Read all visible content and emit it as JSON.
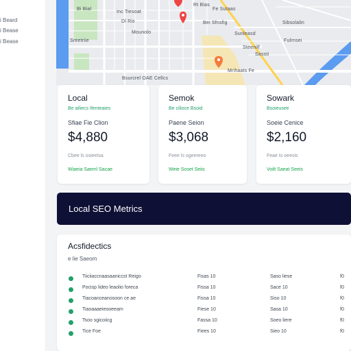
{
  "sidebar": {
    "items": [
      {
        "label": "i Beard"
      },
      {
        "label": "i Bease"
      },
      {
        "label": "i Bease"
      }
    ]
  },
  "map": {
    "labels": [
      "Bi Bial",
      "Dl Ris",
      "Mounolo",
      "Inc Tiesoat",
      "Rt Bias",
      "Bei Sfnsfig",
      "Fe Sutaas",
      "Sreetriie",
      "Sunleasd",
      "Steenilf",
      "Sassti",
      "Fulrnsei",
      "Mrihaats Fe",
      "Sibsolalin",
      "Bsurcrel OAE Cellcs"
    ]
  },
  "cards": [
    {
      "title": "Local",
      "sub": "Be ailiecs Ifenteaies",
      "label": "Sfiae Fie Clion",
      "value": "$4,880",
      "meta": "Cbee ls osieetsa",
      "foot": "Wiaeia Saeml Sacae"
    },
    {
      "title": "Semok",
      "sub": "Be cilioce Bsoid",
      "label": "Paene Seion",
      "value": "$3,068",
      "meta": "Feee ls ogeereeo",
      "foot": "Weie Soset Seiis"
    },
    {
      "title": "Sowark",
      "sub": "Bsoieusee",
      "label": "Soeie Cenice",
      "value": "$2,160",
      "meta": "Feae ts oeesis",
      "foot": "Voilt Saeat Seeis"
    }
  ],
  "banner": {
    "title": "Local SEO Metrics"
  },
  "panel": {
    "title": "Acsfidectics",
    "sub": "e lie Saeom",
    "rows": [
      {
        "name": "Tiiciiaccnaasaaniccst Reigo",
        "c1": "Fisas 10",
        "c2": "Saso liese",
        "c3": "f0"
      },
      {
        "name": "Pocisp lideo leaolio foreca",
        "c1": "Fissa 10",
        "c2": "Sace 10",
        "c3": "f0"
      },
      {
        "name": "Tiacoanceanosoon ce ae",
        "c1": "Fissa 10",
        "c2": "Siso 10",
        "c3": "f0"
      },
      {
        "name": "Tiaoaaaeieooeeam",
        "c1": "Fiese 10",
        "c2": "Sasa 10",
        "c3": "f0"
      },
      {
        "name": "Tsoo sgicoiicg",
        "c1": "Fassa 10",
        "c2": "Soeo liere",
        "c3": "f0"
      },
      {
        "name": "Tice Foe",
        "c1": "Fiees 10",
        "c2": "Sieo 10",
        "c3": "f0"
      }
    ]
  },
  "colors": {
    "navy": "#0f1035",
    "accent_green": "#22a06b",
    "map_marker": "#ef4444",
    "map_water": "#5b9bf0",
    "map_park": "#c8e6c0",
    "map_highlight": "#f5e6b5"
  }
}
